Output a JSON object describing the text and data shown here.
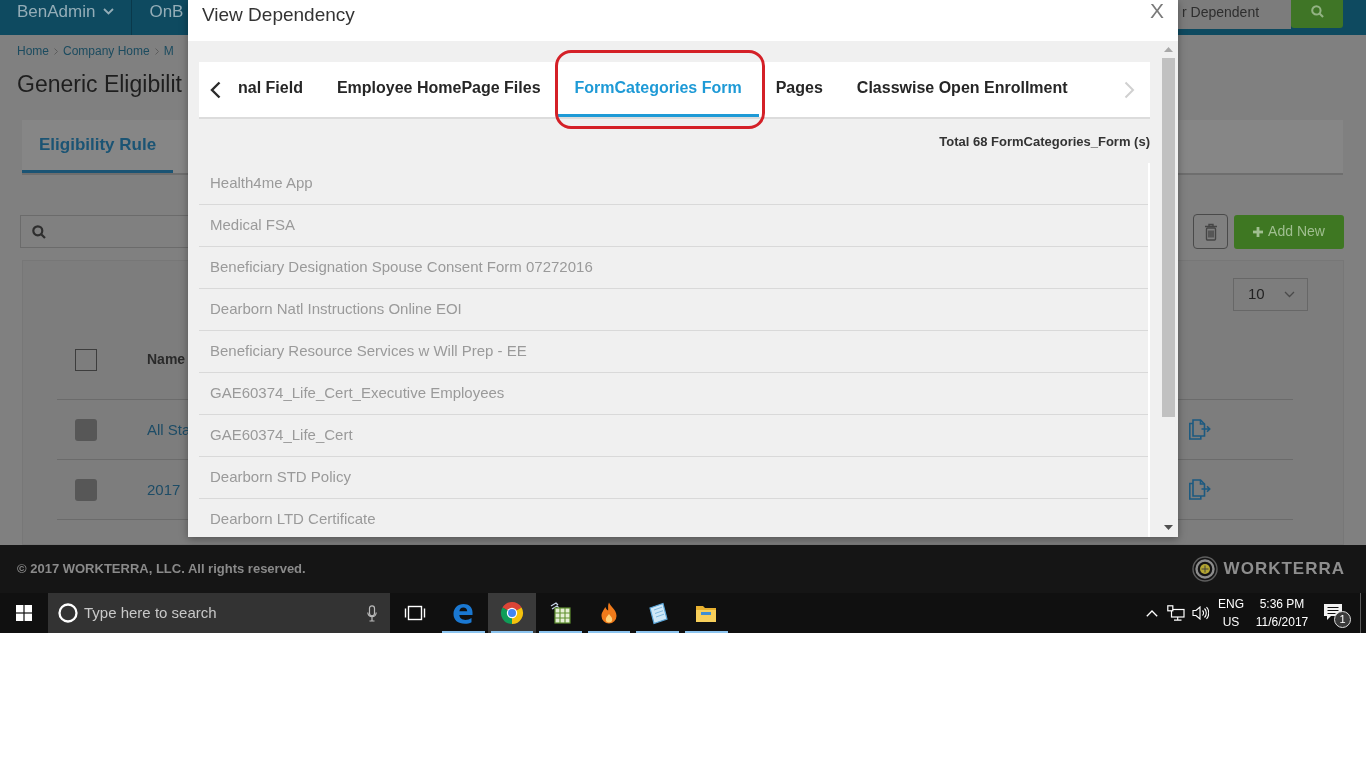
{
  "app_header": {
    "menus": [
      {
        "label": "BenAdmin",
        "dropdown": true
      },
      {
        "label": "OnB",
        "dropdown": false
      }
    ],
    "search": {
      "placeholder": "r Dependent"
    }
  },
  "breadcrumb": [
    "Home",
    "Company Home",
    "M"
  ],
  "page_title": "Generic Eligibilit",
  "page_tabs": [
    {
      "label": "Eligibility Rule",
      "selected": true
    }
  ],
  "toolbar": {
    "add_button": "Add New"
  },
  "table": {
    "page_size": "10",
    "header": {
      "checked": false,
      "columns": [
        "Name"
      ]
    },
    "rows": [
      {
        "checked": false,
        "name": "All Sta"
      },
      {
        "checked": false,
        "name": "2017"
      }
    ]
  },
  "modal": {
    "title": "View Dependency",
    "close": "X",
    "scroll_buttons": {
      "previous": {
        "disabled": false
      },
      "next": {
        "disabled": true
      }
    },
    "tabs": [
      {
        "label": "nal Field",
        "selected": false
      },
      {
        "label": "Employee HomePage Files",
        "selected": false
      },
      {
        "label": "FormCategories Form",
        "selected": true
      },
      {
        "label": "Pages",
        "selected": false
      },
      {
        "label": "Classwise Open Enrollment",
        "selected": false
      }
    ],
    "total": "Total 68 FormCategories_Form (s)",
    "items": [
      "Health4me App",
      "Medical FSA",
      "Beneficiary Designation Spouse Consent Form 07272016",
      "Dearborn Natl Instructions Online EOI",
      "Beneficiary Resource Services w Will Prep - EE",
      "GAE60374_Life_Cert_Executive Employees",
      "GAE60374_Life_Cert",
      "Dearborn STD Policy",
      "Dearborn LTD Certificate"
    ]
  },
  "footer": {
    "copyright": "© 2017 WORKTERRA, LLC. All rights reserved.",
    "brand": "WORKTERRA"
  },
  "taskbar": {
    "search": {
      "placeholder": "Type here to search"
    },
    "apps": [
      {
        "selected": false,
        "running": true
      },
      {
        "selected": true,
        "running": true
      },
      {
        "selected": false,
        "running": true
      },
      {
        "selected": false,
        "running": true
      },
      {
        "selected": false,
        "running": true
      },
      {
        "selected": false,
        "running": true
      }
    ],
    "language": "ENG",
    "region": "US",
    "time": "5:36 PM",
    "date": "11/6/2017",
    "notifications": "1"
  }
}
